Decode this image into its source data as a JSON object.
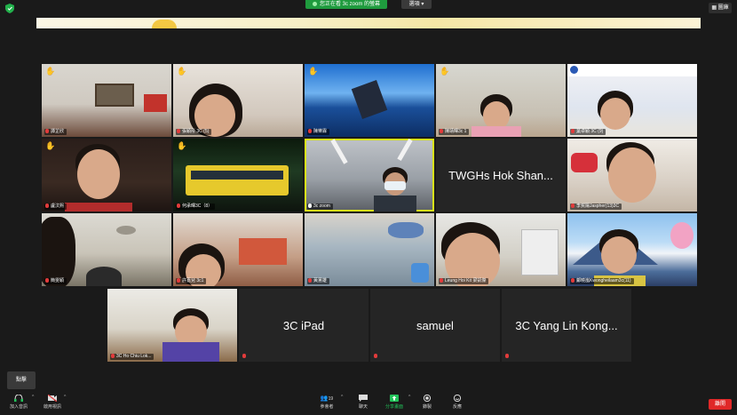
{
  "top": {
    "share_banner": "您正在看 3c zoom 的螢幕",
    "view_option": "選項",
    "gallery_view": "圖庫"
  },
  "tiles_row1": [
    {
      "name": "譚芷欣",
      "hand": true
    },
    {
      "name": "張穎彤 3C (5)",
      "hand": true
    },
    {
      "name": "陳樂霖",
      "hand": true
    },
    {
      "name": "陳靖暉3c 1",
      "hand": true
    },
    {
      "name": "葉卓穎 3C (9)",
      "hand": false
    }
  ],
  "tiles_row2": [
    {
      "name": "盧汶熙",
      "hand": true
    },
    {
      "name": "何承暉3C（8）",
      "hand": true
    },
    {
      "name": "3c zoom",
      "hand": false
    },
    {
      "name": "",
      "label": "TWGHs Hok Shan...",
      "hand": false
    },
    {
      "name": "李賀陽Jaspher(13)3C",
      "hand": false
    }
  ],
  "tiles_row3": [
    {
      "name": "簡雯穎",
      "hand": false
    },
    {
      "name": "許嘉兒 3c1",
      "hand": false
    },
    {
      "name": "黃憲雄",
      "hand": false
    },
    {
      "name": "Leung Hoi Kit 梁凱傑",
      "hand": false
    },
    {
      "name": "鄺曉嵐Kwongheilaam3c(11)",
      "hand": false
    }
  ],
  "tiles_row4": [
    {
      "name": "3C Ho Chiu Lok...",
      "hand": false
    },
    {
      "name": "",
      "label": "3C iPad",
      "hand": false
    },
    {
      "name": "",
      "label": "samuel",
      "hand": false
    },
    {
      "name": "",
      "label": "3C Yang Lin Kong...",
      "hand": false
    }
  ],
  "toolbar": {
    "join_audio": "加入音訊",
    "start_video": "啟用視訊",
    "participants": "參會者",
    "participant_count": "19",
    "chat": "聊天",
    "share": "分享畫面",
    "record": "錄製",
    "reactions": "反應",
    "leave": "離開",
    "tooltip": "點擊"
  },
  "colors": {
    "accent_green": "#1f9b3e",
    "highlight": "#d8e21a",
    "leave_red": "#e02828",
    "hand_yellow": "#f6b32b"
  }
}
